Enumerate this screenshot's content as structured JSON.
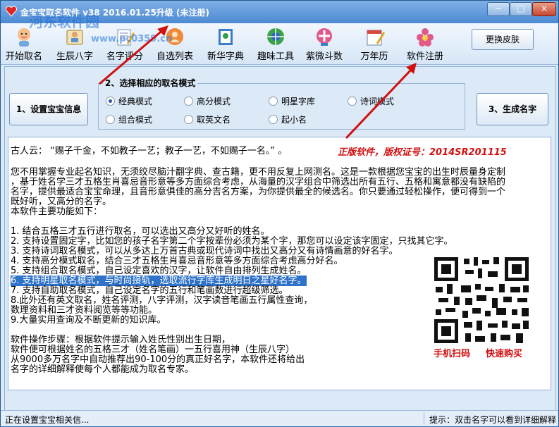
{
  "window": {
    "title": "金宝宝取名软件 v38  2016.01.25升级 (未注册)",
    "controls": [
      "−",
      "□",
      "×"
    ]
  },
  "watermark": {
    "text": "河东软件园",
    "url": "www.pc0359.cn"
  },
  "toolbar": {
    "items": [
      {
        "label": "开始取名",
        "icon": "baby-icon"
      },
      {
        "label": "生辰八字",
        "icon": "scroll-person-icon"
      },
      {
        "label": "名字评分",
        "icon": "pen-paper-icon"
      },
      {
        "label": "自选列表",
        "icon": "list-person-icon"
      },
      {
        "label": "新华字典",
        "icon": "dictionary-icon"
      },
      {
        "label": "趣味工具",
        "icon": "tools-icon"
      },
      {
        "label": "紫微斗数",
        "icon": "star-chart-icon"
      },
      {
        "label": "万年历",
        "icon": "calendar-icon"
      },
      {
        "label": "软件注册",
        "icon": "flower-icon"
      }
    ],
    "skin_button": "更换皮肤"
  },
  "actions": {
    "set_info": "1、设置宝宝信息",
    "generate": "3、生成名字"
  },
  "mode_group": {
    "title": "2、选择相应的取名模式",
    "options": [
      {
        "label": "经典模式",
        "checked": true
      },
      {
        "label": "高分模式",
        "checked": false
      },
      {
        "label": "明星字库",
        "checked": false
      },
      {
        "label": "诗词模式",
        "checked": false
      },
      {
        "label": "组合模式",
        "checked": false
      },
      {
        "label": "取英文名",
        "checked": false
      },
      {
        "label": "起小名",
        "checked": false
      }
    ]
  },
  "content": {
    "quote": "古人云：  “赐子千金，不如教子一艺；教子一艺，不如赐子一名。” 。",
    "license": "正版软件，版权证号：2014SR201115",
    "intro": [
      "您不用掌握专业起名知识，无须绞尽脑汁翻字典、查古籍，更不用反复上网测名。这是一款根据您宝宝的出生时辰量身定制",
      "，基于姓名学三才五格生肖喜忌音形意等多方面综合考虑，从海量的汉字组合中筛选出所有五行、五格和寓意都没有缺陷的",
      "名字，提供最适合宝宝命理，且音形意俱佳的高分吉名方案，为你提供最全的候选名。你只要通过轻松操作，便可得到一个",
      "既好听，又高分的名字。",
      "本软件主要功能如下："
    ],
    "features": [
      "1. 结合五格三才五行进行取名，可以选出又高分又好听的姓名。",
      "2. 支持设置固定字，比如您的孩子名字第二个字按辈份必须为某个字，那您可以设定该字固定，只找其它字。",
      "3. 支持诗词取名模式，可以从多达上万首古典或现代诗词中找出又高分又有诗情画意的好名字。",
      "4. 支持高分模式取名，结合三才五格生肖喜忌音形意等多方面综合考虑高分好名。",
      "5. 支持组合取名模式，自己设定喜欢的汉字，让软件自由排列生成姓名。",
      "6. 支持明星取名模式，与时尚接轨，选取流行字库生成明日之星好名字。",
      "7. 支持自助取名模式，自己设定名字的五行和笔画数进行超级筛选。",
      "8.此外还有英文取名，姓名评测，八字评测，汉字读音笔画五行属性查询，",
      "   数理资料和三才资料阅览等等功能。",
      "9.大量实用查询及不断更新的知识库。"
    ],
    "steps": [
      "软件操作步骤：根据软件提示输入姓氏性别出生日期，",
      "软件便可根据姓名的五格三才（姓名笔画）一五行喜用神（生辰八字）",
      "从9000多万名字中自动推荐出90-100分的真正好名字，本软件还将给出",
      "名字的详细解释使每个人都能成为取名专家。"
    ],
    "qr_caption_left": "手机扫码",
    "qr_caption_right": "快速购买"
  },
  "status": {
    "left": "正在设置宝宝相关信...",
    "right": "提示：双击名字可以看到详细解释"
  },
  "colors": {
    "accent_red": "#d11010",
    "highlight_blue": "#2e72c9",
    "window_bg": "#dce9f7"
  }
}
